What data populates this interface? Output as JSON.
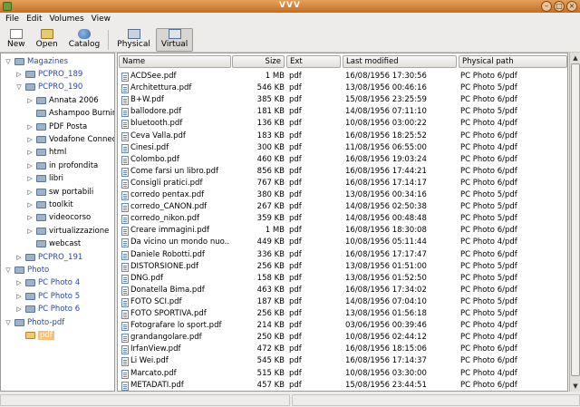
{
  "window": {
    "title": "VVV"
  },
  "menu": [
    "File",
    "Edit",
    "Volumes",
    "View"
  ],
  "toolbar": {
    "new": "New",
    "open": "Open",
    "catalog": "Catalog",
    "physical": "Physical",
    "virtual": "Virtual"
  },
  "tree": [
    {
      "label": "Magazines",
      "indent": 0,
      "expander": "down",
      "blue": true
    },
    {
      "label": "PCPRO_189",
      "indent": 1,
      "expander": "right",
      "blue": true
    },
    {
      "label": "PCPRO_190",
      "indent": 1,
      "expander": "down",
      "blue": true
    },
    {
      "label": "Annata 2006",
      "indent": 2,
      "expander": "right",
      "blue": false
    },
    {
      "label": "Ashampoo Burning",
      "indent": 2,
      "expander": "none",
      "blue": false
    },
    {
      "label": "PDF Posta",
      "indent": 2,
      "expander": "right",
      "blue": false
    },
    {
      "label": "Vodafone Connect",
      "indent": 2,
      "expander": "right",
      "blue": false
    },
    {
      "label": "html",
      "indent": 2,
      "expander": "right",
      "blue": false
    },
    {
      "label": "in profondita",
      "indent": 2,
      "expander": "right",
      "blue": false
    },
    {
      "label": "libri",
      "indent": 2,
      "expander": "right",
      "blue": false
    },
    {
      "label": "sw portabili",
      "indent": 2,
      "expander": "right",
      "blue": false
    },
    {
      "label": "toolkit",
      "indent": 2,
      "expander": "right",
      "blue": false
    },
    {
      "label": "videocorso",
      "indent": 2,
      "expander": "right",
      "blue": false
    },
    {
      "label": "virtualizzazione",
      "indent": 2,
      "expander": "right",
      "blue": false
    },
    {
      "label": "webcast",
      "indent": 2,
      "expander": "none",
      "blue": false
    },
    {
      "label": "PCPRO_191",
      "indent": 1,
      "expander": "right",
      "blue": true
    },
    {
      "label": "Photo",
      "indent": 0,
      "expander": "down",
      "blue": true
    },
    {
      "label": "PC Photo 4",
      "indent": 1,
      "expander": "right",
      "blue": true
    },
    {
      "label": "PC Photo 5",
      "indent": 1,
      "expander": "right",
      "blue": true
    },
    {
      "label": "PC Photo 6",
      "indent": 1,
      "expander": "right",
      "blue": true
    },
    {
      "label": "Photo-pdf",
      "indent": 0,
      "expander": "down",
      "blue": true
    },
    {
      "label": "pdf",
      "indent": 1,
      "expander": "none",
      "blue": false,
      "selected": true
    }
  ],
  "columns": [
    "Name",
    "Size",
    "Ext",
    "Last modified",
    "Physical path"
  ],
  "files": [
    [
      "ACDSee.pdf",
      "1 MB",
      "pdf",
      "16/08/1956 17:30:56",
      "PC Photo 6/pdf"
    ],
    [
      "Architettura.pdf",
      "546 KB",
      "pdf",
      "13/08/1956 00:46:16",
      "PC Photo 5/pdf"
    ],
    [
      "B+W.pdf",
      "385 KB",
      "pdf",
      "15/08/1956 23:25:59",
      "PC Photo 6/pdf"
    ],
    [
      "ballodore.pdf",
      "181 KB",
      "pdf",
      "14/08/1956 07:11:10",
      "PC Photo 5/pdf"
    ],
    [
      "bluetooth.pdf",
      "136 KB",
      "pdf",
      "10/08/1956 03:00:22",
      "PC Photo 4/pdf"
    ],
    [
      "Ceva Valla.pdf",
      "183 KB",
      "pdf",
      "16/08/1956 18:25:52",
      "PC Photo 6/pdf"
    ],
    [
      "Cinesi.pdf",
      "300 KB",
      "pdf",
      "11/08/1956 06:55:00",
      "PC Photo 4/pdf"
    ],
    [
      "Colombo.pdf",
      "460 KB",
      "pdf",
      "16/08/1956 19:03:24",
      "PC Photo 6/pdf"
    ],
    [
      "Come farsi un libro.pdf",
      "856 KB",
      "pdf",
      "16/08/1956 17:44:21",
      "PC Photo 6/pdf"
    ],
    [
      "Consigli pratici.pdf",
      "767 KB",
      "pdf",
      "16/08/1956 17:14:17",
      "PC Photo 6/pdf"
    ],
    [
      "corredo pentax.pdf",
      "380 KB",
      "pdf",
      "13/08/1956 00:34:16",
      "PC Photo 5/pdf"
    ],
    [
      "corredo_CANON.pdf",
      "267 KB",
      "pdf",
      "14/08/1956 02:50:38",
      "PC Photo 5/pdf"
    ],
    [
      "corredo_nikon.pdf",
      "359 KB",
      "pdf",
      "14/08/1956 00:48:48",
      "PC Photo 5/pdf"
    ],
    [
      "Creare immagini.pdf",
      "1 MB",
      "pdf",
      "16/08/1956 18:30:08",
      "PC Photo 6/pdf"
    ],
    [
      "Da vicino un mondo nuo...",
      "449 KB",
      "pdf",
      "10/08/1956 05:11:44",
      "PC Photo 4/pdf"
    ],
    [
      "Daniele Robotti.pdf",
      "336 KB",
      "pdf",
      "16/08/1956 17:17:47",
      "PC Photo 6/pdf"
    ],
    [
      "DISTORSIONE.pdf",
      "256 KB",
      "pdf",
      "13/08/1956 01:51:00",
      "PC Photo 5/pdf"
    ],
    [
      "DNG.pdf",
      "158 KB",
      "pdf",
      "13/08/1956 01:52:50",
      "PC Photo 5/pdf"
    ],
    [
      "Donatella Bima.pdf",
      "463 KB",
      "pdf",
      "16/08/1956 17:34:02",
      "PC Photo 6/pdf"
    ],
    [
      "FOTO SCI.pdf",
      "187 KB",
      "pdf",
      "14/08/1956 07:04:10",
      "PC Photo 5/pdf"
    ],
    [
      "FOTO SPORTIVA.pdf",
      "256 KB",
      "pdf",
      "13/08/1956 01:56:18",
      "PC Photo 5/pdf"
    ],
    [
      "Fotografare lo sport.pdf",
      "214 KB",
      "pdf",
      "03/06/1956 00:39:46",
      "PC Photo 4/pdf"
    ],
    [
      "grandangolare.pdf",
      "250 KB",
      "pdf",
      "10/08/1956 02:44:12",
      "PC Photo 4/pdf"
    ],
    [
      "IrfanView.pdf",
      "472 KB",
      "pdf",
      "16/08/1956 18:15:06",
      "PC Photo 6/pdf"
    ],
    [
      "Li Wei.pdf",
      "545 KB",
      "pdf",
      "16/08/1956 17:14:37",
      "PC Photo 6/pdf"
    ],
    [
      "Marcato.pdf",
      "515 KB",
      "pdf",
      "10/08/1956 03:30:00",
      "PC Photo 4/pdf"
    ],
    [
      "METADATI.pdf",
      "457 KB",
      "pdf",
      "15/08/1956 23:44:51",
      "PC Photo 6/pdf"
    ]
  ]
}
